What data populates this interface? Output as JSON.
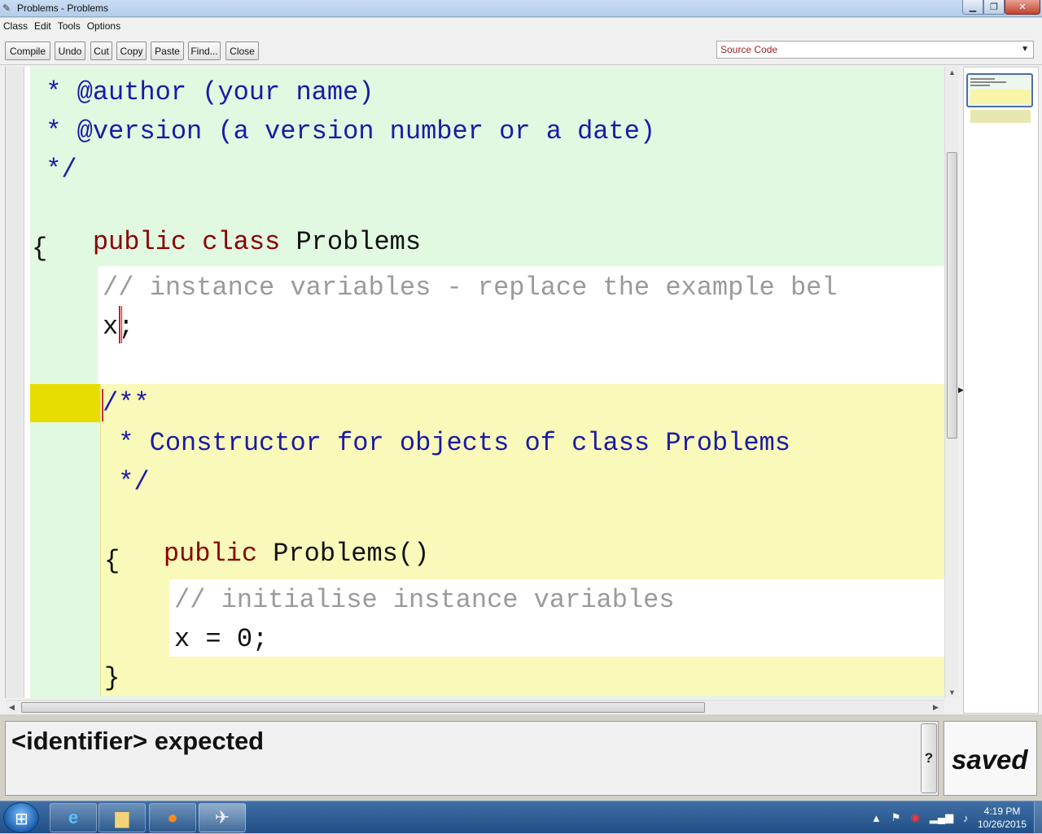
{
  "window": {
    "title": "Problems - Problems"
  },
  "menu": {
    "items": [
      "Class",
      "Edit",
      "Tools",
      "Options"
    ]
  },
  "toolbar": {
    "compile": "Compile",
    "undo": "Undo",
    "cut": "Cut",
    "copy": "Copy",
    "paste": "Paste",
    "find": "Find...",
    "close": "Close",
    "view_select": "Source Code"
  },
  "code": {
    "l1": " * @author (your name)",
    "l2": " * @version (a version number or a date)",
    "l3": " */",
    "l4_kw": "public",
    "l4_kw2": "class",
    "l4_name": "Problems",
    "l5": "{",
    "l6": "// instance variables - replace the example bel",
    "l7": "x;",
    "l8": "/**",
    "l9": " * Constructor for objects of class Problems",
    "l10": " */",
    "l11_kw": "public",
    "l11_rest": "Problems()",
    "l12": "{",
    "l13": "// initialise instance variables",
    "l14": "x = 0;",
    "l15": "}"
  },
  "status": {
    "message": "<identifier> expected",
    "help": "?",
    "saved": "saved"
  },
  "taskbar": {
    "time": "4:19 PM",
    "date": "10/26/2015"
  }
}
